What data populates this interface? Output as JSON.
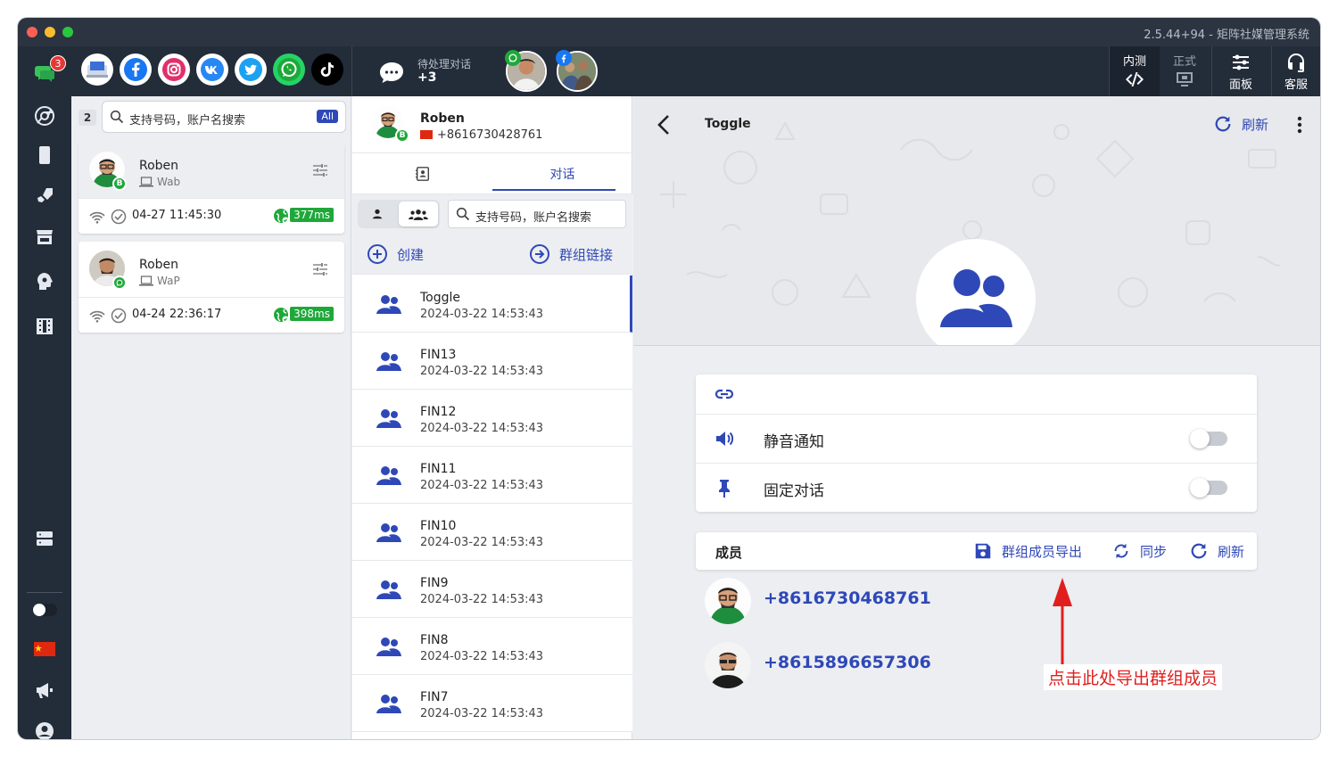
{
  "window": {
    "version_title": "2.5.44+94 - 矩阵社媒管理系统"
  },
  "rail": {
    "badge_count": "3"
  },
  "topbar": {
    "pending_label": "待处理对话",
    "pending_count": "+3",
    "buttons": [
      {
        "label": "内测",
        "icon": "code-icon"
      },
      {
        "label": "正式",
        "icon": "monitor-icon"
      },
      {
        "label": "面板",
        "icon": "sliders-icon"
      },
      {
        "label": "客服",
        "icon": "headset-icon"
      }
    ]
  },
  "accounts": {
    "count": "2",
    "search_placeholder": "支持号码，账户名搜索",
    "filter_chip": "All",
    "items": [
      {
        "name": "Roben",
        "type": "Wab",
        "time": "04-27 11:45:30",
        "ping": "377ms",
        "badge": "B"
      },
      {
        "name": "Roben",
        "type": "WaP",
        "time": "04-24 22:36:17",
        "ping": "398ms",
        "badge": ""
      }
    ]
  },
  "conversations": {
    "header": {
      "name": "Roben",
      "phone": "+8616730428761",
      "badge": "B"
    },
    "tab_chat": "对话",
    "search_placeholder": "支持号码，账户名搜索",
    "create_label": "创建",
    "group_link_label": "群组链接",
    "items": [
      {
        "name": "Toggle",
        "date": "2024-03-22 14:53:43"
      },
      {
        "name": "FIN13",
        "date": "2024-03-22 14:53:43"
      },
      {
        "name": "FIN12",
        "date": "2024-03-22 14:53:43"
      },
      {
        "name": "FIN11",
        "date": "2024-03-22 14:53:43"
      },
      {
        "name": "FIN10",
        "date": "2024-03-22 14:53:43"
      },
      {
        "name": "FIN9",
        "date": "2024-03-22 14:53:43"
      },
      {
        "name": "FIN8",
        "date": "2024-03-22 14:53:43"
      },
      {
        "name": "FIN7",
        "date": "2024-03-22 14:53:43"
      }
    ]
  },
  "detail": {
    "title": "Toggle",
    "refresh_label": "刷新",
    "settings": [
      {
        "label": "",
        "icon": "link-icon"
      },
      {
        "label": "静音通知",
        "icon": "speaker-icon",
        "on": false
      },
      {
        "label": "固定对话",
        "icon": "pin-icon",
        "on": false
      }
    ],
    "members": {
      "title": "成员",
      "export_label": "群组成员导出",
      "sync_label": "同步",
      "refresh_label": "刷新",
      "list": [
        {
          "phone": "+8616730468761"
        },
        {
          "phone": "+8615896657306"
        }
      ]
    },
    "annotation": "点击此处导出群组成员"
  },
  "colors": {
    "accent": "#2f48b7",
    "rail": "#232c39",
    "ping": "#1fa83a",
    "annotation": "#e01e1e"
  }
}
